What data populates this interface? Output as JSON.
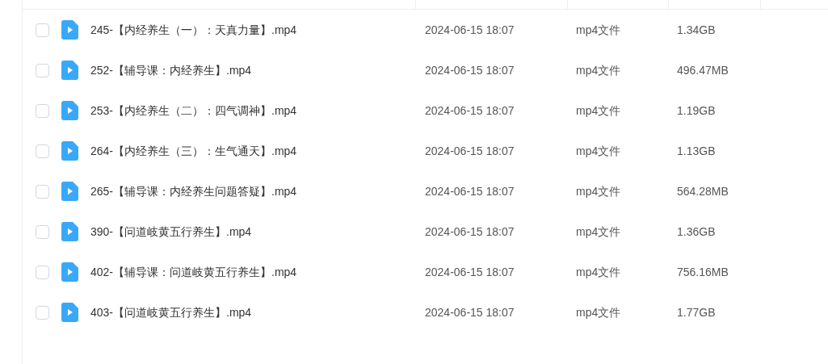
{
  "files": [
    {
      "name": "245-【内经养生（一）：天真力量】.mp4",
      "modified": "2024-06-15 18:07",
      "type": "mp4文件",
      "size": "1.34GB",
      "checked": false
    },
    {
      "name": "252-【辅导课：内经养生】.mp4",
      "modified": "2024-06-15 18:07",
      "type": "mp4文件",
      "size": "496.47MB",
      "checked": false
    },
    {
      "name": "253-【内经养生（二）：四气调神】.mp4",
      "modified": "2024-06-15 18:07",
      "type": "mp4文件",
      "size": "1.19GB",
      "checked": false
    },
    {
      "name": "264-【内经养生（三）：生气通天】.mp4",
      "modified": "2024-06-15 18:07",
      "type": "mp4文件",
      "size": "1.13GB",
      "checked": false
    },
    {
      "name": "265-【辅导课：内经养生问题答疑】.mp4",
      "modified": "2024-06-15 18:07",
      "type": "mp4文件",
      "size": "564.28MB",
      "checked": false
    },
    {
      "name": "390-【问道岐黄五行养生】.mp4",
      "modified": "2024-06-15 18:07",
      "type": "mp4文件",
      "size": "1.36GB",
      "checked": false
    },
    {
      "name": "402-【辅导课：问道岐黄五行养生】.mp4",
      "modified": "2024-06-15 18:07",
      "type": "mp4文件",
      "size": "756.16MB",
      "checked": false
    },
    {
      "name": "403-【问道岐黄五行养生】.mp4",
      "modified": "2024-06-15 18:07",
      "type": "mp4文件",
      "size": "1.77GB",
      "checked": false
    }
  ]
}
